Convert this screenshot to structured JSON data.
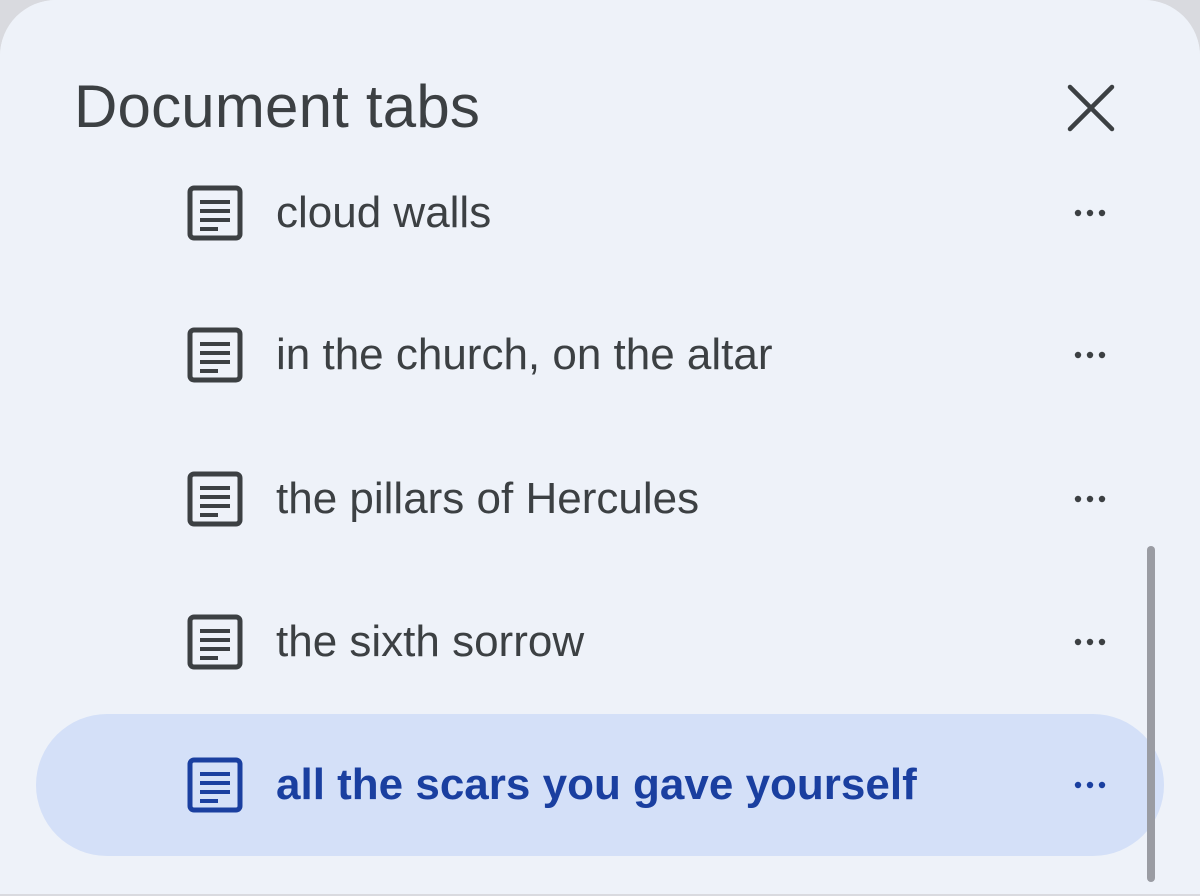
{
  "header": {
    "title": "Document tabs",
    "close_icon": "close-icon"
  },
  "tabs": [
    {
      "label": "cloud walls",
      "icon": "document-icon",
      "selected": false
    },
    {
      "label": "in the church, on the altar",
      "icon": "document-icon",
      "selected": false
    },
    {
      "label": "the pillars of Hercules",
      "icon": "document-icon",
      "selected": false
    },
    {
      "label": "the sixth sorrow",
      "icon": "document-icon",
      "selected": false
    },
    {
      "label": "all the scars you gave yourself",
      "icon": "document-icon",
      "selected": true
    }
  ],
  "more_icon": "more-horizontal-icon",
  "colors": {
    "panel_bg": "#eef2f9",
    "selected_bg": "#d4e0f8",
    "selected_text": "#1a3fa0",
    "text": "#3c4043"
  }
}
